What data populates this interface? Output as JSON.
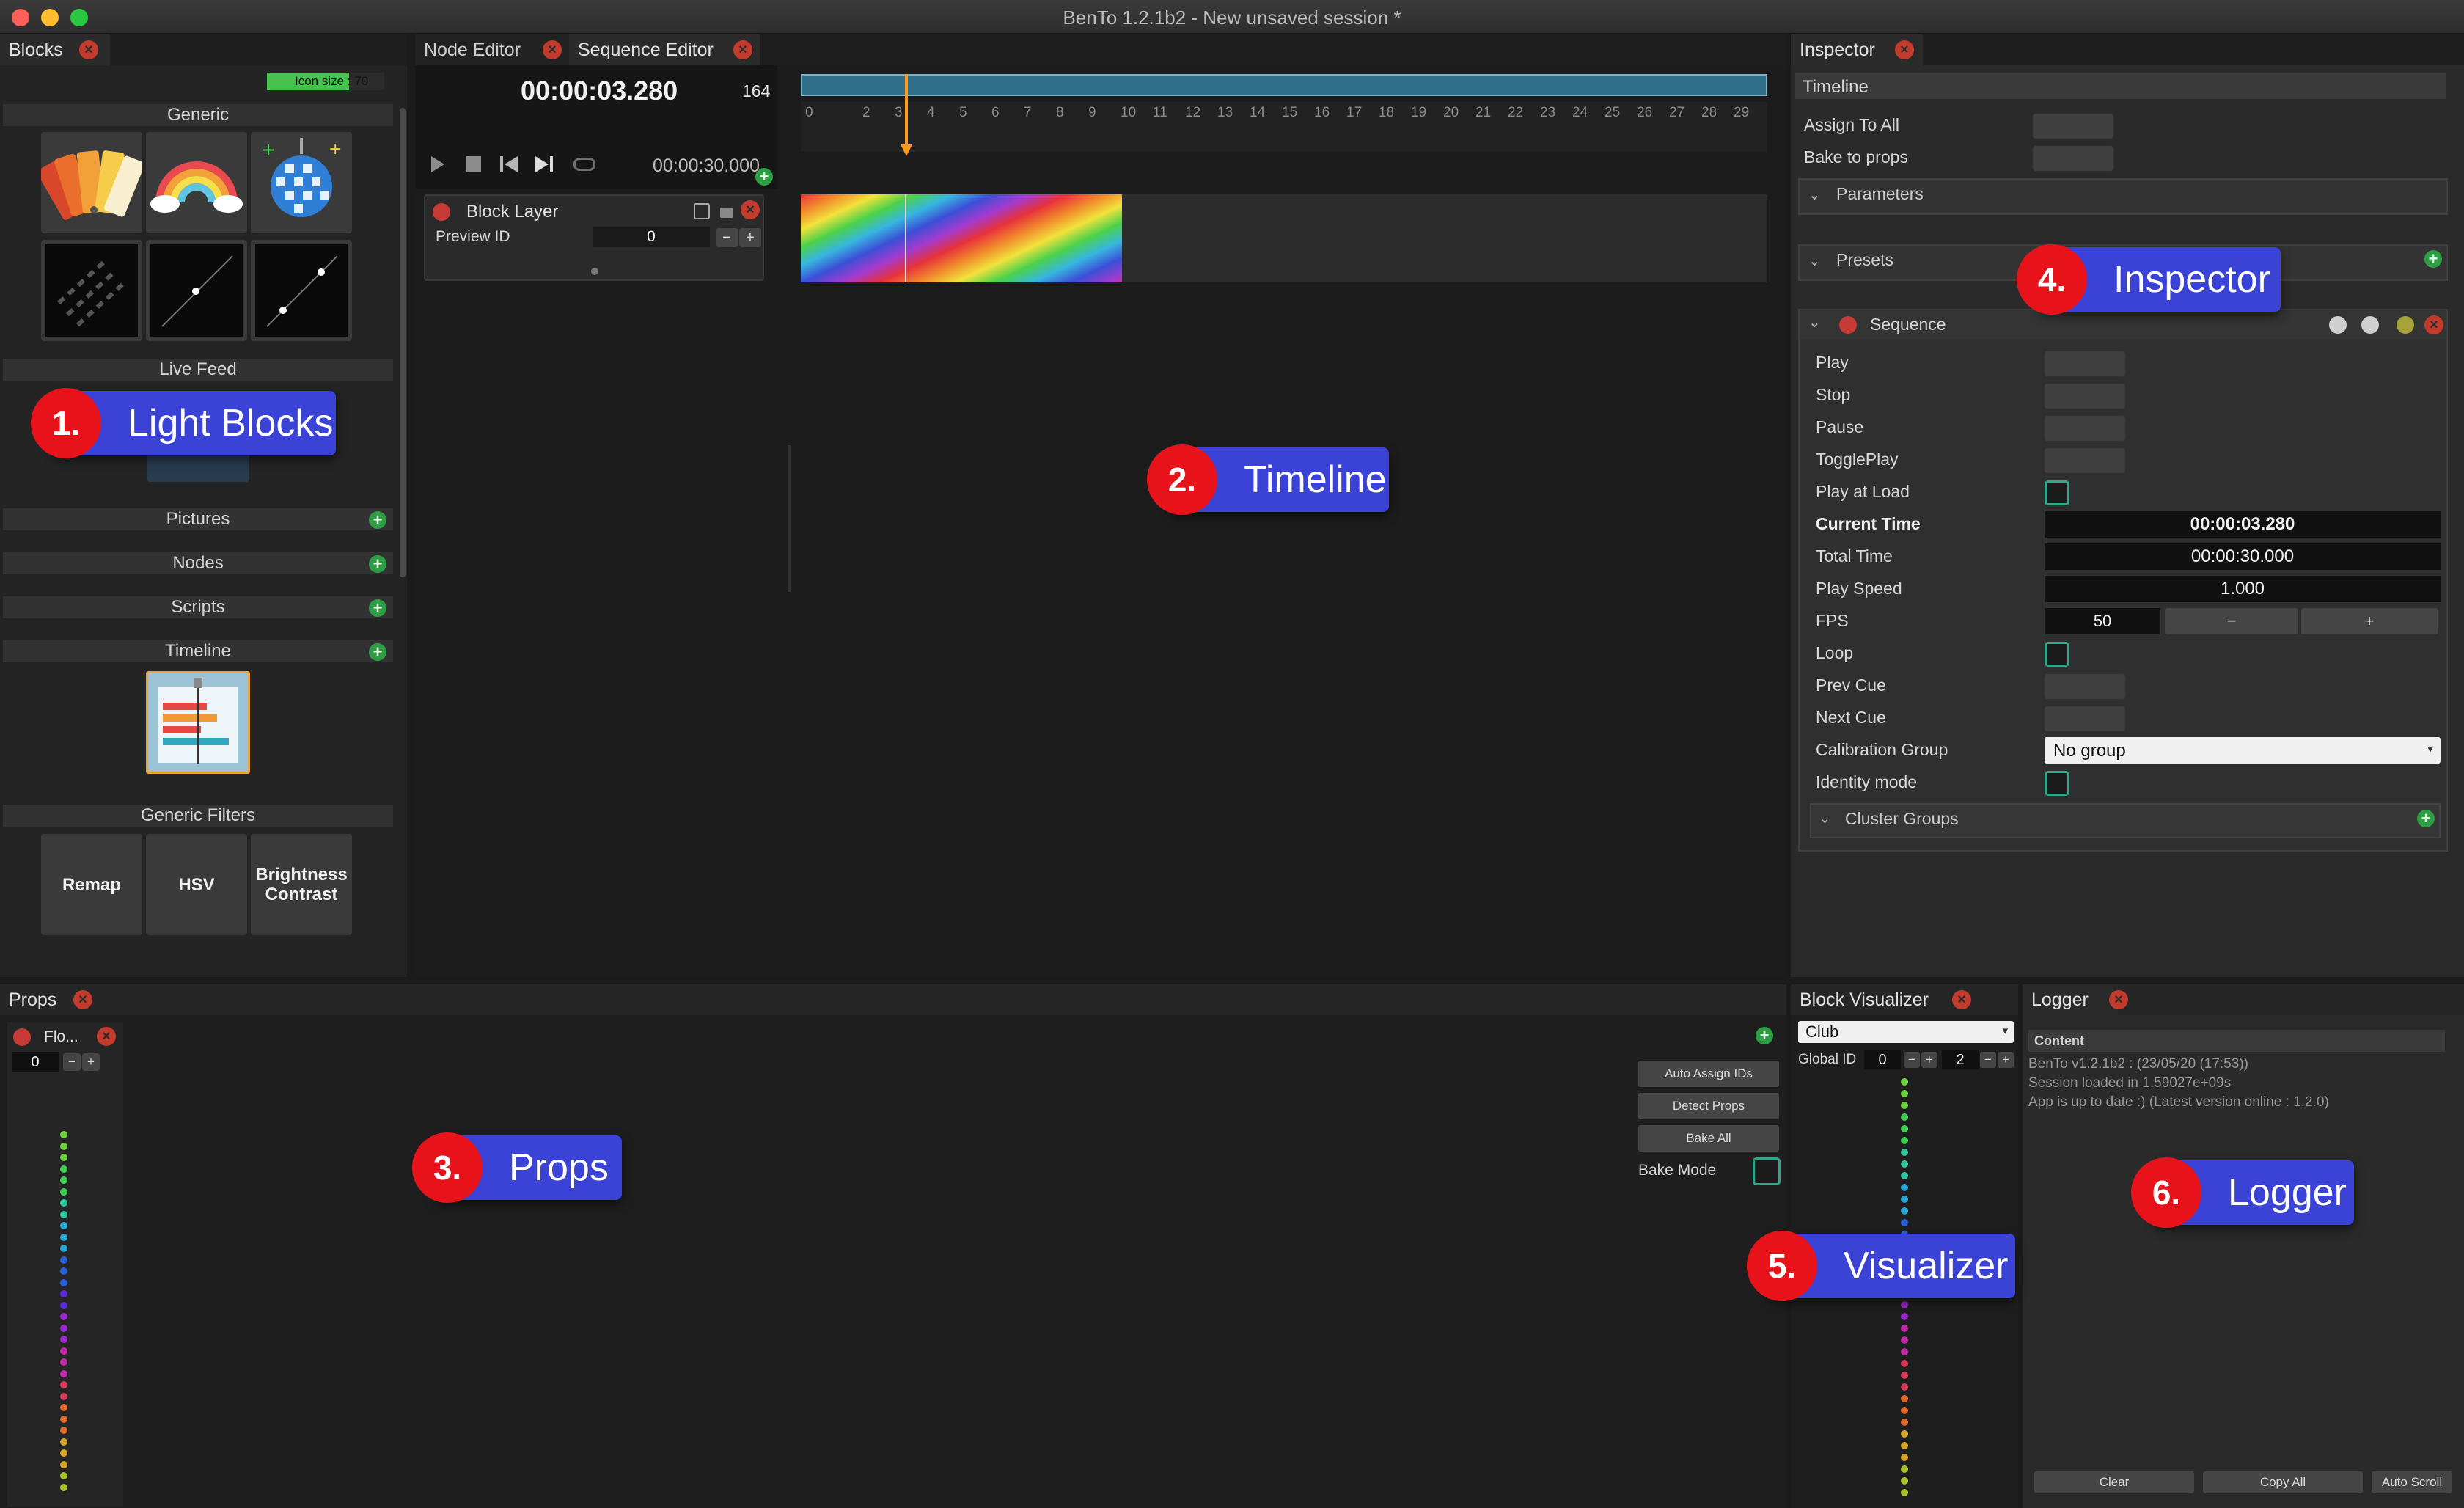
{
  "window": {
    "title": "BenTo 1.2.1b2 - New unsaved session *"
  },
  "blocks": {
    "tab": "Blocks",
    "icon_size": "Icon size : 70",
    "sections": {
      "generic": "Generic",
      "live_feed": "Live Feed",
      "pictures": "Pictures",
      "nodes": "Nodes",
      "scripts": "Scripts",
      "timeline": "Timeline",
      "generic_filters": "Generic Filters"
    },
    "filters": [
      "Remap",
      "HSV",
      "Brightness Contrast"
    ]
  },
  "editor": {
    "tabs": [
      "Node Editor",
      "Sequence Editor"
    ],
    "current_time": "00:00:03.280",
    "frame": "164",
    "total_time": "00:00:30.000",
    "ruler": [
      "0",
      "2",
      "3",
      "4",
      "5",
      "6",
      "7",
      "8",
      "9",
      "10",
      "11",
      "12",
      "13",
      "14",
      "15",
      "16",
      "17",
      "18",
      "19",
      "20",
      "21",
      "22",
      "23",
      "24",
      "25",
      "26",
      "27",
      "28",
      "29"
    ],
    "layer": {
      "name": "Block Layer",
      "preview_label": "Preview ID",
      "preview_value": "0"
    }
  },
  "inspector": {
    "tab": "Inspector",
    "timeline_header": "Timeline",
    "assign_to_all": "Assign To All",
    "bake_to_props": "Bake to props",
    "parameters": "Parameters",
    "presets": "Presets",
    "sequence": "Sequence",
    "rows": {
      "play": "Play",
      "stop": "Stop",
      "pause": "Pause",
      "toggleplay": "TogglePlay",
      "play_at_load": "Play at Load",
      "current_time": "Current Time",
      "current_time_value": "00:00:03.280",
      "total_time": "Total Time",
      "total_time_value": "00:00:30.000",
      "play_speed": "Play Speed",
      "play_speed_value": "1.000",
      "fps": "FPS",
      "fps_value": "50",
      "loop": "Loop",
      "prev_cue": "Prev Cue",
      "next_cue": "Next Cue",
      "calibration_group": "Calibration Group",
      "calibration_value": "No group",
      "identity_mode": "Identity mode",
      "cluster_groups": "Cluster Groups"
    }
  },
  "props": {
    "tab": "Props",
    "item_name": "Flo...",
    "item_id": "0",
    "buttons": [
      "Auto Assign IDs",
      "Detect Props",
      "Bake All"
    ],
    "bake_mode": "Bake Mode"
  },
  "visualizer": {
    "tab": "Block Visualizer",
    "preset": "Club",
    "global_id_label": "Global ID",
    "global_id": "0",
    "second_value": "2"
  },
  "logger": {
    "tab": "Logger",
    "content_header": "Content",
    "lines": [
      "BenTo v1.2.1b2 : (23/05/20 (17:53))",
      "Session loaded in 1.59027e+09s",
      "App is up to date :) (Latest version online : 1.2.0)"
    ],
    "buttons": [
      "Clear",
      "Copy All",
      "Auto Scroll"
    ]
  },
  "callouts": [
    {
      "num": "1.",
      "label": "Light Blocks"
    },
    {
      "num": "2.",
      "label": "Timeline"
    },
    {
      "num": "3.",
      "label": "Props"
    },
    {
      "num": "4.",
      "label": "Inspector"
    },
    {
      "num": "5.",
      "label": "Visualizer"
    },
    {
      "num": "6.",
      "label": "Logger"
    }
  ],
  "colors": {
    "accent_blue": "#3a43d6",
    "callout_red": "#e8121a",
    "close_red": "#c23b2c",
    "add_green": "#2e9e44",
    "playhead": "#ff9a1a"
  }
}
